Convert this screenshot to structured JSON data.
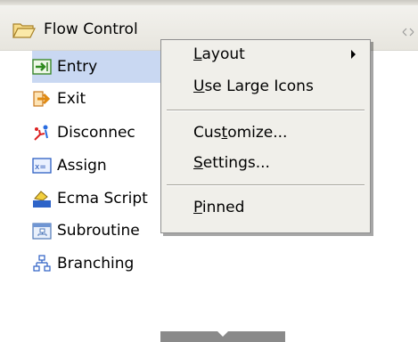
{
  "palette": {
    "drawer": {
      "title": "Flow Control",
      "folder_icon": "folder-open-icon",
      "resize_icon": "resize-handle-icon"
    },
    "items": [
      {
        "label": "Entry",
        "icon": "entry-arrow-icon",
        "selected": true
      },
      {
        "label": "Exit",
        "icon": "exit-arrow-icon",
        "selected": false
      },
      {
        "label": "Disconnec",
        "icon": "disconnect-icon",
        "selected": false
      },
      {
        "label": "Assign",
        "icon": "assign-icon",
        "selected": false
      },
      {
        "label": "Ecma Script",
        "icon": "ecma-script-icon",
        "selected": false
      },
      {
        "label": "Subroutine",
        "icon": "subroutine-icon",
        "selected": false
      },
      {
        "label": "Branching",
        "icon": "branching-icon",
        "selected": false
      }
    ],
    "scroll_icon": "chevron-down-icon"
  },
  "context_menu": {
    "layout": {
      "pre": "",
      "mn": "L",
      "post": "ayout",
      "submenu": true
    },
    "large_icons": {
      "pre": "",
      "mn": "U",
      "post": "se Large Icons"
    },
    "customize": {
      "pre": "Cus",
      "mn": "t",
      "post": "omize..."
    },
    "settings": {
      "pre": "",
      "mn": "S",
      "post": "ettings..."
    },
    "pinned": {
      "pre": "",
      "mn": "P",
      "post": "inned"
    }
  },
  "colors": {
    "selection": "#c9d8f2",
    "menu_bg": "#f0efea",
    "header_bg": "#ecebe5"
  }
}
